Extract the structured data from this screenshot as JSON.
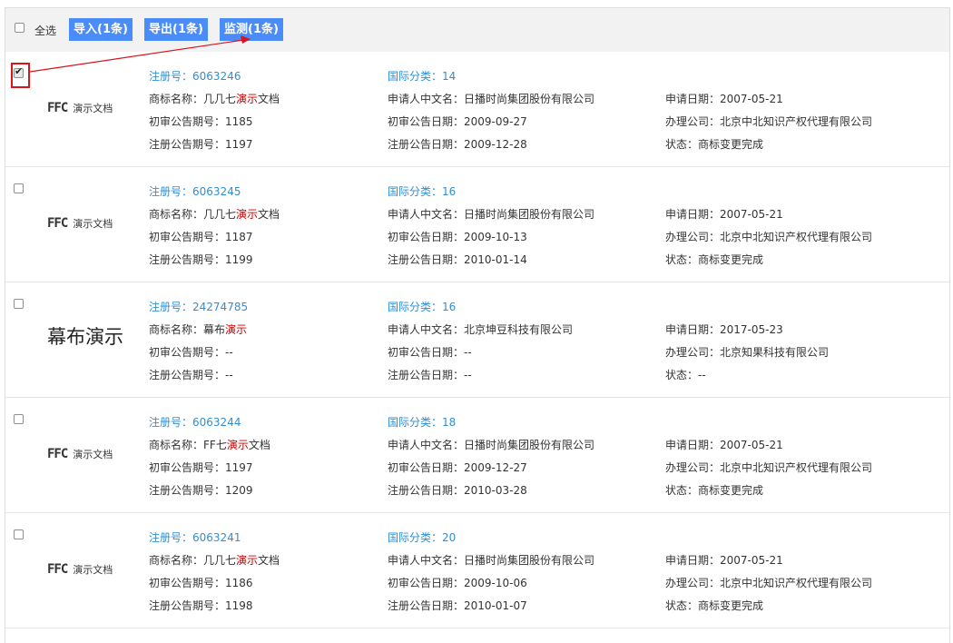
{
  "toolbar": {
    "select_all": "全选",
    "import_label": "导入(1条)",
    "export_label": "导出(1条)",
    "monitor_label": "监测(1条)"
  },
  "labels": {
    "reg_no": "注册号：",
    "intl_class": "国际分类：",
    "name": "商标名称：",
    "applicant": "申请人中文名：",
    "app_date": "申请日期：",
    "prelim_no": "初审公告期号：",
    "prelim_date": "初审公告日期：",
    "agency": "办理公司：",
    "reg_pub_no": "注册公告期号：",
    "reg_pub_date": "注册公告日期：",
    "status": "状态："
  },
  "records": [
    {
      "checked": true,
      "logo_type": "ffc",
      "logo_mark": "FFC",
      "logo_cn": "演示文档",
      "reg_no": "6063246",
      "intl_class": "14",
      "name_pre": "几几七",
      "name_hl": "演示",
      "name_post": "文档",
      "applicant": "日播时尚集团股份有限公司",
      "app_date": "2007-05-21",
      "prelim_no": "1185",
      "prelim_date": "2009-09-27",
      "agency": "北京中北知识产权代理有限公司",
      "reg_pub_no": "1197",
      "reg_pub_date": "2009-12-28",
      "status": "商标变更完成"
    },
    {
      "checked": false,
      "logo_type": "ffc",
      "logo_mark": "FFC",
      "logo_cn": "演示文档",
      "reg_no": "6063245",
      "intl_class": "16",
      "name_pre": "几几七",
      "name_hl": "演示",
      "name_post": "文档",
      "applicant": "日播时尚集团股份有限公司",
      "app_date": "2007-05-21",
      "prelim_no": "1187",
      "prelim_date": "2009-10-13",
      "agency": "北京中北知识产权代理有限公司",
      "reg_pub_no": "1199",
      "reg_pub_date": "2010-01-14",
      "status": "商标变更完成"
    },
    {
      "checked": false,
      "logo_type": "text",
      "logo_text": "幕布演示",
      "reg_no": "24274785",
      "intl_class": "16",
      "name_pre": "幕布",
      "name_hl": "演示",
      "name_post": "",
      "applicant": "北京坤豆科技有限公司",
      "app_date": "2017-05-23",
      "prelim_no": "--",
      "prelim_date": "--",
      "agency": "北京知果科技有限公司",
      "reg_pub_no": "--",
      "reg_pub_date": "--",
      "status": "--"
    },
    {
      "checked": false,
      "logo_type": "ffc",
      "logo_mark": "FFC",
      "logo_cn": "演示文档",
      "reg_no": "6063244",
      "intl_class": "18",
      "name_pre": "FF七",
      "name_hl": "演示",
      "name_post": "文档",
      "applicant": "日播时尚集团股份有限公司",
      "app_date": "2007-05-21",
      "prelim_no": "1197",
      "prelim_date": "2009-12-27",
      "agency": "北京中北知识产权代理有限公司",
      "reg_pub_no": "1209",
      "reg_pub_date": "2010-03-28",
      "status": "商标变更完成"
    },
    {
      "checked": false,
      "logo_type": "ffc",
      "logo_mark": "FFC",
      "logo_cn": "演示文档",
      "reg_no": "6063241",
      "intl_class": "20",
      "name_pre": "几几七",
      "name_hl": "演示",
      "name_post": "文档",
      "applicant": "日播时尚集团股份有限公司",
      "app_date": "2007-05-21",
      "prelim_no": "1186",
      "prelim_date": "2009-10-06",
      "agency": "北京中北知识产权代理有限公司",
      "reg_pub_no": "1198",
      "reg_pub_date": "2010-01-07",
      "status": "商标变更完成"
    }
  ],
  "colors": {
    "accent": "#4b8df8",
    "link": "#2f8fd4",
    "highlight": "#cc0000",
    "annotation": "#d9141c"
  }
}
